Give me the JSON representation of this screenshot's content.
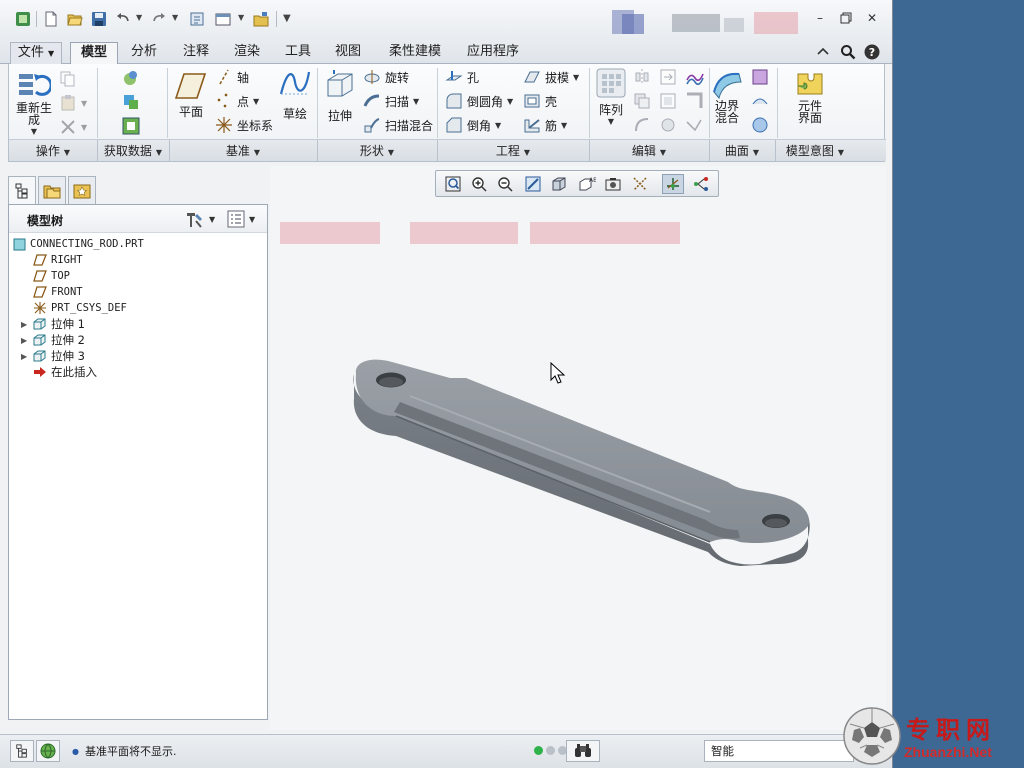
{
  "quick_access": {
    "icons": [
      "window-icon",
      "new-file-icon",
      "open-folder-icon",
      "save-icon",
      "undo-icon",
      "redo-icon",
      "regenerate-icon",
      "windows-icon",
      "close-folder-icon",
      "customize-icon"
    ]
  },
  "tabs": [
    {
      "label": "文件",
      "name": "tab-file"
    },
    {
      "label": "模型",
      "name": "tab-model"
    },
    {
      "label": "分析",
      "name": "tab-analysis"
    },
    {
      "label": "注释",
      "name": "tab-annotate"
    },
    {
      "label": "渲染",
      "name": "tab-render"
    },
    {
      "label": "工具",
      "name": "tab-tools"
    },
    {
      "label": "视图",
      "name": "tab-view"
    },
    {
      "label": "柔性建模",
      "name": "tab-flexible-modeling"
    },
    {
      "label": "应用程序",
      "name": "tab-applications"
    }
  ],
  "active_tab": "模型",
  "ribbon": {
    "operations": {
      "regenerate": "重新生成",
      "group_label": "操作"
    },
    "get_data": {
      "group_label": "获取数据"
    },
    "datum": {
      "plane": "平面",
      "axis": "轴",
      "point": "点",
      "csys": "坐标系",
      "sketch": "草绘",
      "group_label": "基准"
    },
    "shapes": {
      "extrude": "拉伸",
      "revolve": "旋转",
      "sweep": "扫描",
      "swept_blend": "扫描混合",
      "group_label": "形状"
    },
    "engineering": {
      "hole": "孔",
      "round": "倒圆角",
      "chamfer": "倒角",
      "draft": "拔模",
      "shell": "壳",
      "rib": "筋",
      "group_label": "工程"
    },
    "editing": {
      "pattern": "阵列",
      "group_label": "编辑"
    },
    "surfaces": {
      "boundary_blend": "边界混合",
      "group_label": "曲面"
    },
    "model_intent": {
      "component_interface": "元件界面",
      "group_label": "模型意图"
    }
  },
  "model_tree": {
    "title": "模型树",
    "items": [
      {
        "label": "CONNECTING_ROD.PRT",
        "icon": "part-icon",
        "expandable": false
      },
      {
        "label": "RIGHT",
        "icon": "datum-plane-icon",
        "expandable": false
      },
      {
        "label": "TOP",
        "icon": "datum-plane-icon",
        "expandable": false
      },
      {
        "label": "FRONT",
        "icon": "datum-plane-icon",
        "expandable": false
      },
      {
        "label": "PRT_CSYS_DEF",
        "icon": "csys-icon",
        "expandable": false
      },
      {
        "label": "拉伸 1",
        "icon": "extrude-icon",
        "expandable": true
      },
      {
        "label": "拉伸 2",
        "icon": "extrude-icon",
        "expandable": true
      },
      {
        "label": "拉伸 3",
        "icon": "extrude-icon",
        "expandable": true
      },
      {
        "label": "在此插入",
        "icon": "insert-here-arrow-icon",
        "expandable": false
      }
    ]
  },
  "status": {
    "message": "基准平面将不显示.",
    "filter": "智能"
  },
  "watermark": {
    "text": "专职网",
    "url": "Zhuanzhi.Net"
  },
  "colors": {
    "desktop": "#3d6894",
    "app_bg": "#f0f2f4",
    "model_gray": "#8a9096",
    "watermark_red": "#c61a1a"
  }
}
